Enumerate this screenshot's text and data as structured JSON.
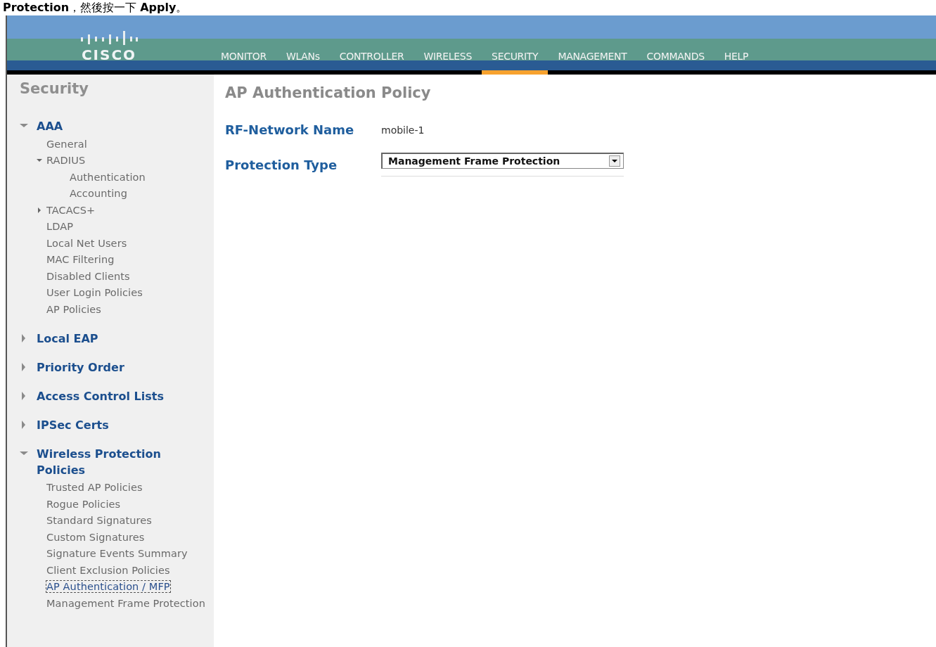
{
  "caption": "**Protection**，然後按一下 **Apply**。",
  "header": {
    "logo": "CISCO",
    "menu": [
      {
        "label": "MONITOR",
        "selected": false
      },
      {
        "label": "WLANs",
        "selected": false
      },
      {
        "label": "CONTROLLER",
        "selected": false
      },
      {
        "label": "WIRELESS",
        "selected": false
      },
      {
        "label": "SECURITY",
        "selected": true
      },
      {
        "label": "MANAGEMENT",
        "selected": false
      },
      {
        "label": "COMMANDS",
        "selected": false
      },
      {
        "label": "HELP",
        "selected": false
      }
    ]
  },
  "sidebar": {
    "title": "Security",
    "sections": [
      {
        "label": "AAA",
        "expanded": true,
        "children": [
          {
            "label": "General",
            "selected": false
          },
          {
            "label": "RADIUS",
            "selected": false,
            "expanded": true,
            "children": [
              {
                "label": "Authentication",
                "selected": false
              },
              {
                "label": "Accounting",
                "selected": false
              }
            ]
          },
          {
            "label": "TACACS+",
            "selected": false,
            "expanded": false
          },
          {
            "label": "LDAP",
            "selected": false
          },
          {
            "label": "Local Net Users",
            "selected": false
          },
          {
            "label": "MAC Filtering",
            "selected": false
          },
          {
            "label": "Disabled Clients",
            "selected": false
          },
          {
            "label": "User Login Policies",
            "selected": false
          },
          {
            "label": "AP Policies",
            "selected": false
          }
        ]
      },
      {
        "label": "Local EAP",
        "expanded": false
      },
      {
        "label": "Priority Order",
        "expanded": false
      },
      {
        "label": "Access Control Lists",
        "expanded": false
      },
      {
        "label": "IPSec Certs",
        "expanded": false
      },
      {
        "label": "Wireless Protection Policies",
        "expanded": true,
        "children": [
          {
            "label": "Trusted AP Policies",
            "selected": false
          },
          {
            "label": "Rogue Policies",
            "selected": false
          },
          {
            "label": "Standard Signatures",
            "selected": false
          },
          {
            "label": "Custom Signatures",
            "selected": false
          },
          {
            "label": "Signature Events Summary",
            "selected": false
          },
          {
            "label": "Client Exclusion Policies",
            "selected": false
          },
          {
            "label": "AP Authentication / MFP",
            "selected": true
          },
          {
            "label": "Management Frame Protection",
            "selected": false
          }
        ]
      }
    ]
  },
  "content": {
    "title": "AP Authentication Policy",
    "fields": [
      {
        "kind": "text",
        "label": "RF-Network Name",
        "value": "mobile-1"
      },
      {
        "kind": "select",
        "label": "Protection Type",
        "value": "Management Frame Protection"
      }
    ]
  }
}
